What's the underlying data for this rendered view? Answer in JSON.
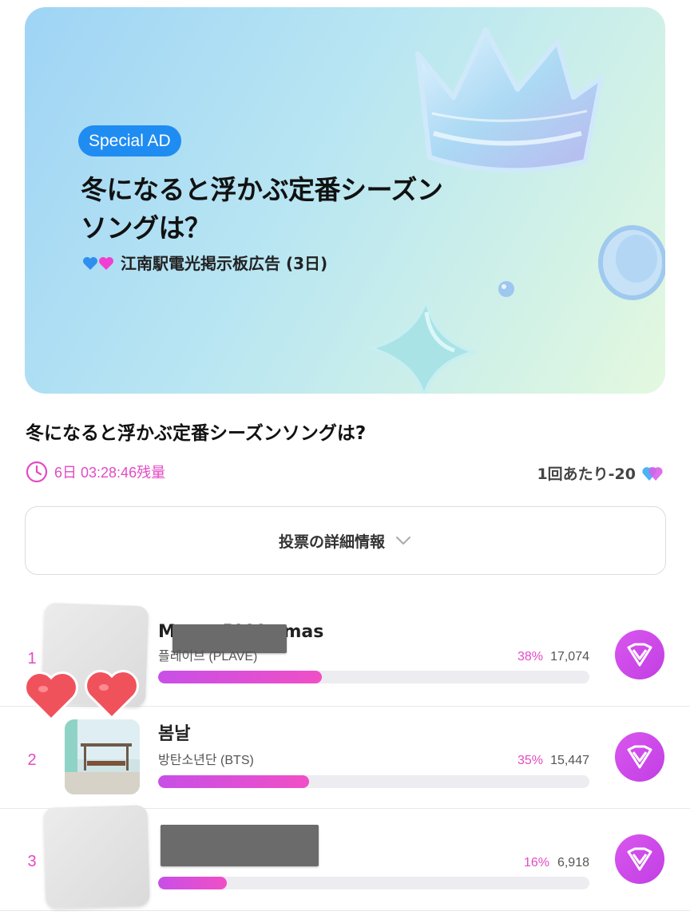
{
  "banner": {
    "badge": "Special AD",
    "title": "冬になると浮かぶ定番シーズンソングは？",
    "subtitle": "江南駅電光掲示板広告 (3日)",
    "heart_colors": [
      "#2f8ff0",
      "#f03fd0"
    ]
  },
  "poll": {
    "title": "冬になると浮かぶ定番シーズンソングは?",
    "timer": "6日 03:28:46残量",
    "cost": "1回あたり-20",
    "detail_button": "投票の詳細情報"
  },
  "entries": [
    {
      "rank": "1",
      "song": "Merry PLLIstmas",
      "artist": "플레이브 (PLAVE)",
      "pct": "38%",
      "votes": "17,074",
      "share": 0.38
    },
    {
      "rank": "2",
      "song": "봄날",
      "artist": "방탄소년단 (BTS)",
      "pct": "35%",
      "votes": "15,447",
      "share": 0.35
    },
    {
      "rank": "3",
      "song": "",
      "artist": "",
      "pct": "16%",
      "votes": "6,918",
      "share": 0.16
    }
  ],
  "colors": {
    "accent": "#e34ac4",
    "vote_button": "#cf4be9",
    "badge": "#1f8cf2"
  }
}
